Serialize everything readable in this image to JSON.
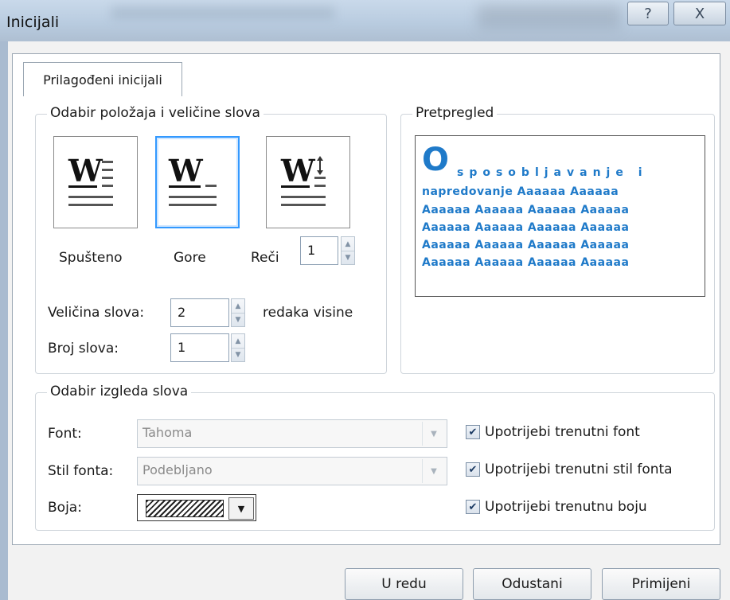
{
  "window": {
    "title": "Inicijali",
    "help_glyph": "?",
    "close_glyph": "X"
  },
  "tab": {
    "label": "Prilagođeni inicijali"
  },
  "position_group": {
    "title": "Odabir položaja i veličine slova",
    "options": [
      {
        "label": "Spušteno",
        "glyph": "W",
        "selected": false
      },
      {
        "label": "Gore",
        "glyph": "W",
        "selected": true
      },
      {
        "label": "Reči",
        "glyph": "W",
        "selected": false
      }
    ],
    "reci_value": "1",
    "size_label": "Veličina slova:",
    "size_value": "2",
    "size_unit": "redaka visine",
    "count_label": "Broj slova:",
    "count_value": "1"
  },
  "preview": {
    "title": "Pretpregled",
    "initial": "O",
    "first_line": "sposobljavanje i",
    "lines": [
      "napredovanje  Aaaaaa  Aaaaaa",
      "Aaaaaa  Aaaaaa  Aaaaaa  Aaaaaa",
      "Aaaaaa  Aaaaaa  Aaaaaa  Aaaaaa",
      "Aaaaaa  Aaaaaa  Aaaaaa  Aaaaaa",
      "Aaaaaa  Aaaaaa  Aaaaaa  Aaaaaa"
    ],
    "text_color": "#1f7ac9"
  },
  "appearance_group": {
    "title": "Odabir izgleda slova",
    "font_label": "Font:",
    "font_value": "Tahoma",
    "style_label": "Stil fonta:",
    "style_value": "Podebljano",
    "color_label": "Boja:",
    "use_font": "Upotrijebi trenutni font",
    "use_style": "Upotrijebi trenutni stil fonta",
    "use_color": "Upotrijebi trenutnu boju",
    "checked": true
  },
  "buttons": {
    "ok": "U redu",
    "cancel": "Odustani",
    "apply": "Primijeni"
  }
}
